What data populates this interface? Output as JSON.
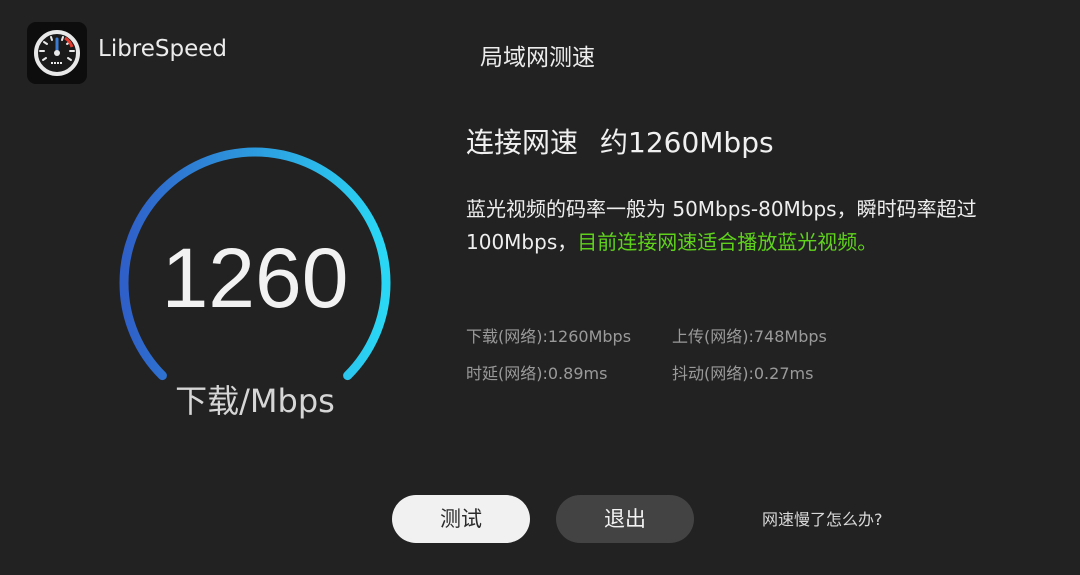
{
  "header": {
    "app_name": "LibreSpeed",
    "title": "局域网测速"
  },
  "gauge": {
    "value": "1260",
    "unit": "下载/Mbps",
    "colors": {
      "start": "#2f5fc9",
      "end": "#2ad8f5"
    }
  },
  "result": {
    "label": "连接网速",
    "value": "约1260Mbps",
    "description": "蓝光视频的码率一般为 50Mbps-80Mbps，瞬时码率超过 100Mbps，",
    "verdict": "目前连接网速适合播放蓝光视频。",
    "verdict_color": "#5fd21c"
  },
  "stats": {
    "download": "下载(网络):1260Mbps",
    "upload": "上传(网络):748Mbps",
    "latency": "时延(网络):0.89ms",
    "jitter": "抖动(网络):0.27ms"
  },
  "actions": {
    "test_label": "测试",
    "exit_label": "退出",
    "help_label": "网速慢了怎么办?"
  },
  "icons": {
    "logo": "speedometer-icon"
  }
}
